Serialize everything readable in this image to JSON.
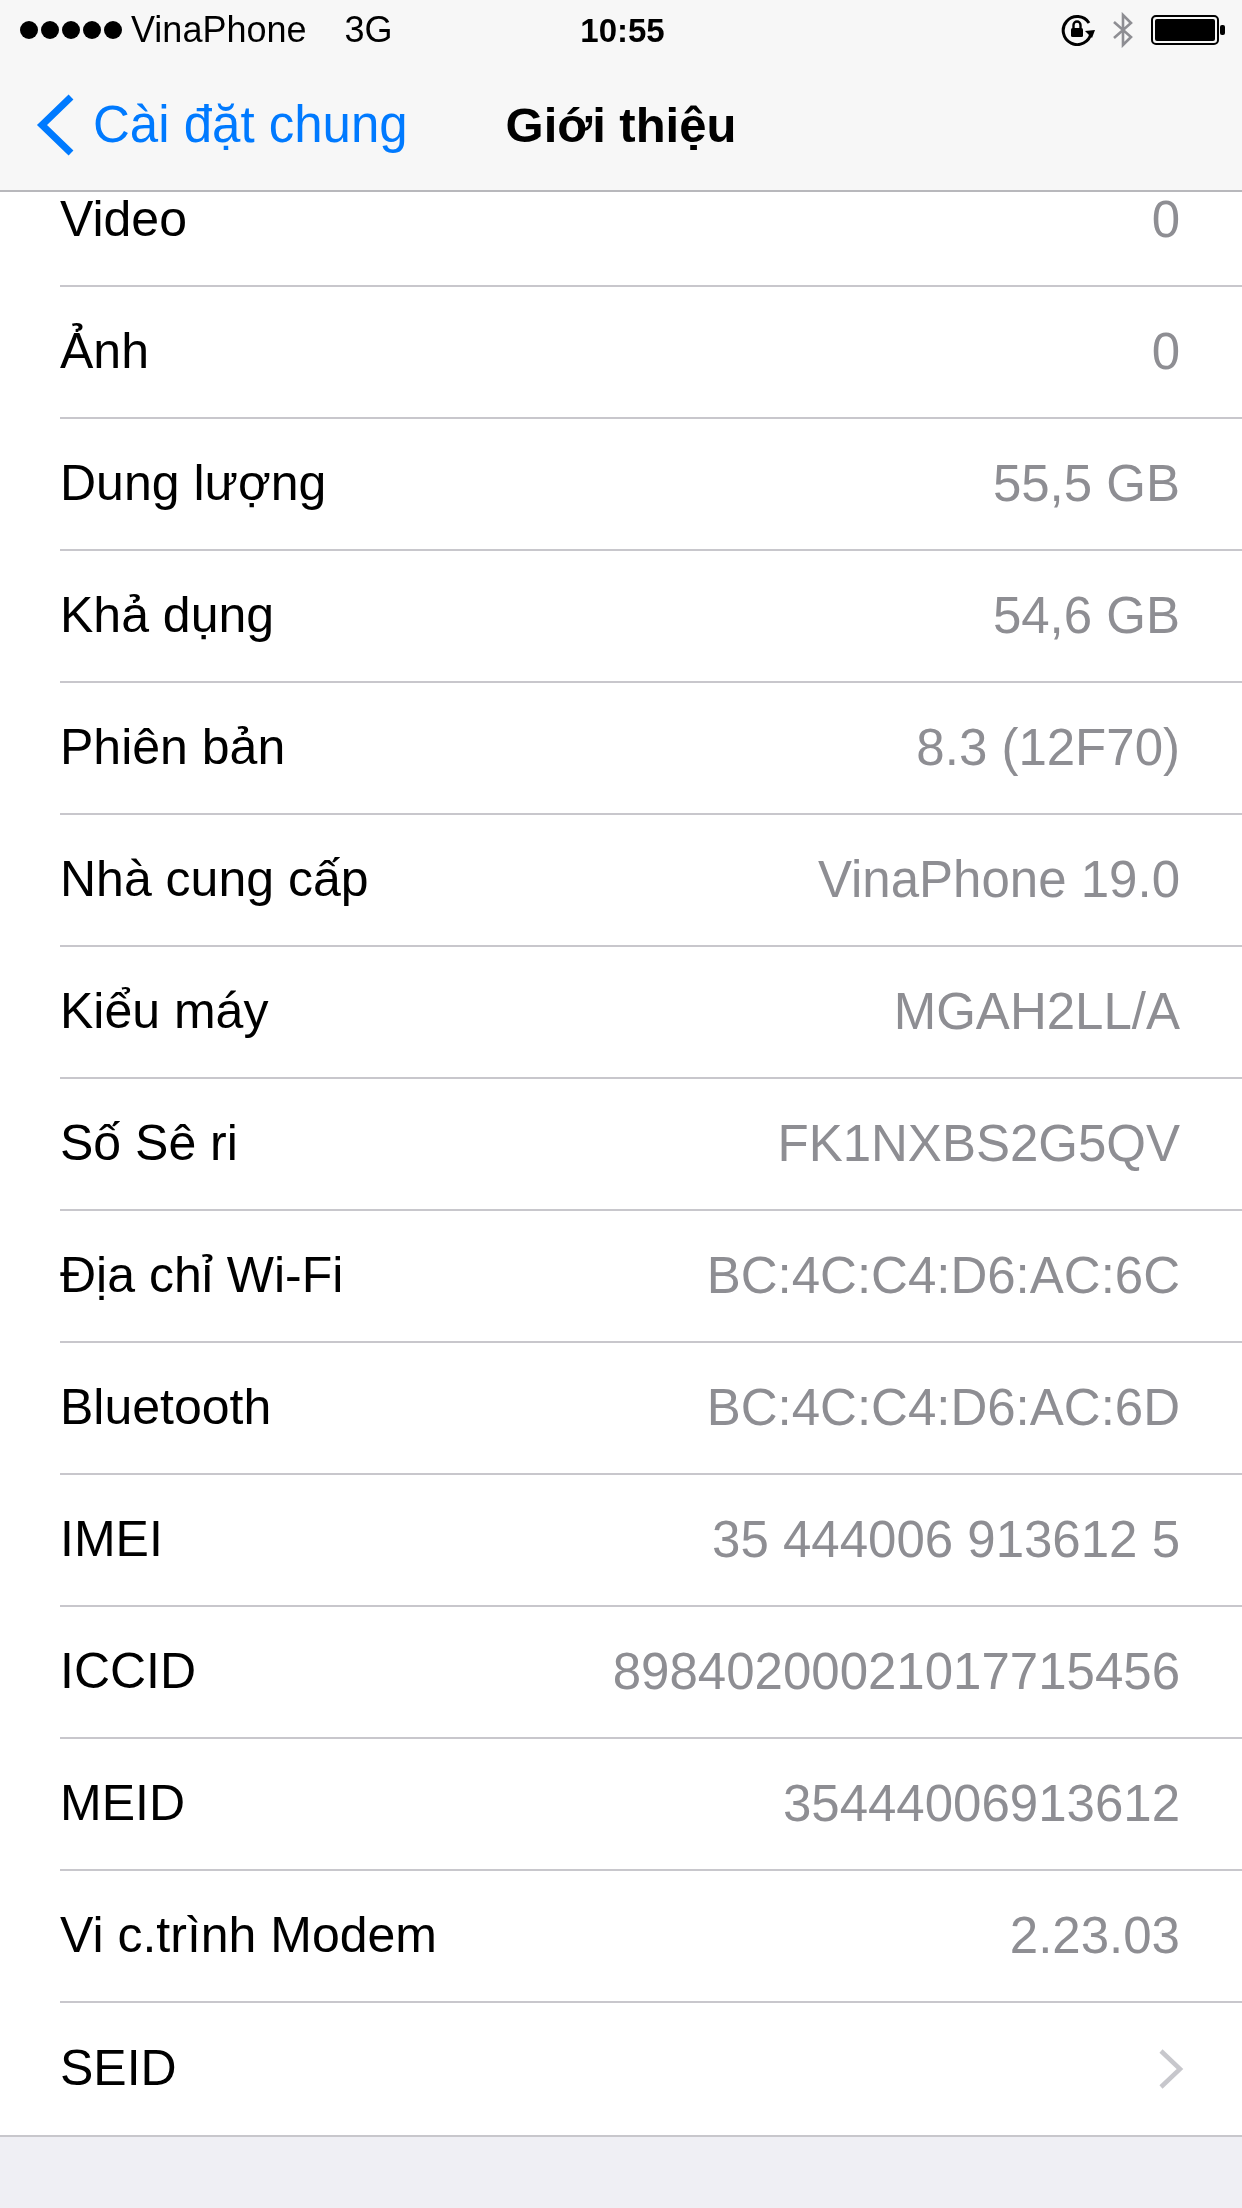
{
  "status_bar": {
    "carrier": "VinaPhone",
    "network": "3G",
    "time": "10:55"
  },
  "nav_bar": {
    "back_label": "Cài đặt chung",
    "title": "Giới thiệu"
  },
  "rows": [
    {
      "kind": "value",
      "label": "Video",
      "value": "0"
    },
    {
      "kind": "value",
      "label": "Ảnh",
      "value": "0"
    },
    {
      "kind": "value",
      "label": "Dung lượng",
      "value": "55,5 GB"
    },
    {
      "kind": "value",
      "label": "Khả dụng",
      "value": "54,6 GB"
    },
    {
      "kind": "value",
      "label": "Phiên bản",
      "value": "8.3 (12F70)"
    },
    {
      "kind": "value",
      "label": "Nhà cung cấp",
      "value": "VinaPhone 19.0"
    },
    {
      "kind": "value",
      "label": "Kiểu máy",
      "value": "MGAH2LL/A"
    },
    {
      "kind": "value",
      "label": "Số Sê ri",
      "value": "FK1NXBS2G5QV"
    },
    {
      "kind": "value",
      "label": "Địa chỉ Wi-Fi",
      "value": "BC:4C:C4:D6:AC:6C"
    },
    {
      "kind": "value",
      "label": "Bluetooth",
      "value": "BC:4C:C4:D6:AC:6D"
    },
    {
      "kind": "value",
      "label": "IMEI",
      "value": "35 444006 913612 5"
    },
    {
      "kind": "value",
      "label": "ICCID",
      "value": "89840200021017715456"
    },
    {
      "kind": "value",
      "label": "MEID",
      "value": "35444006913612"
    },
    {
      "kind": "value",
      "label": "Vi c.trình Modem",
      "value": "2.23.03"
    },
    {
      "kind": "link",
      "label": "SEID"
    }
  ]
}
